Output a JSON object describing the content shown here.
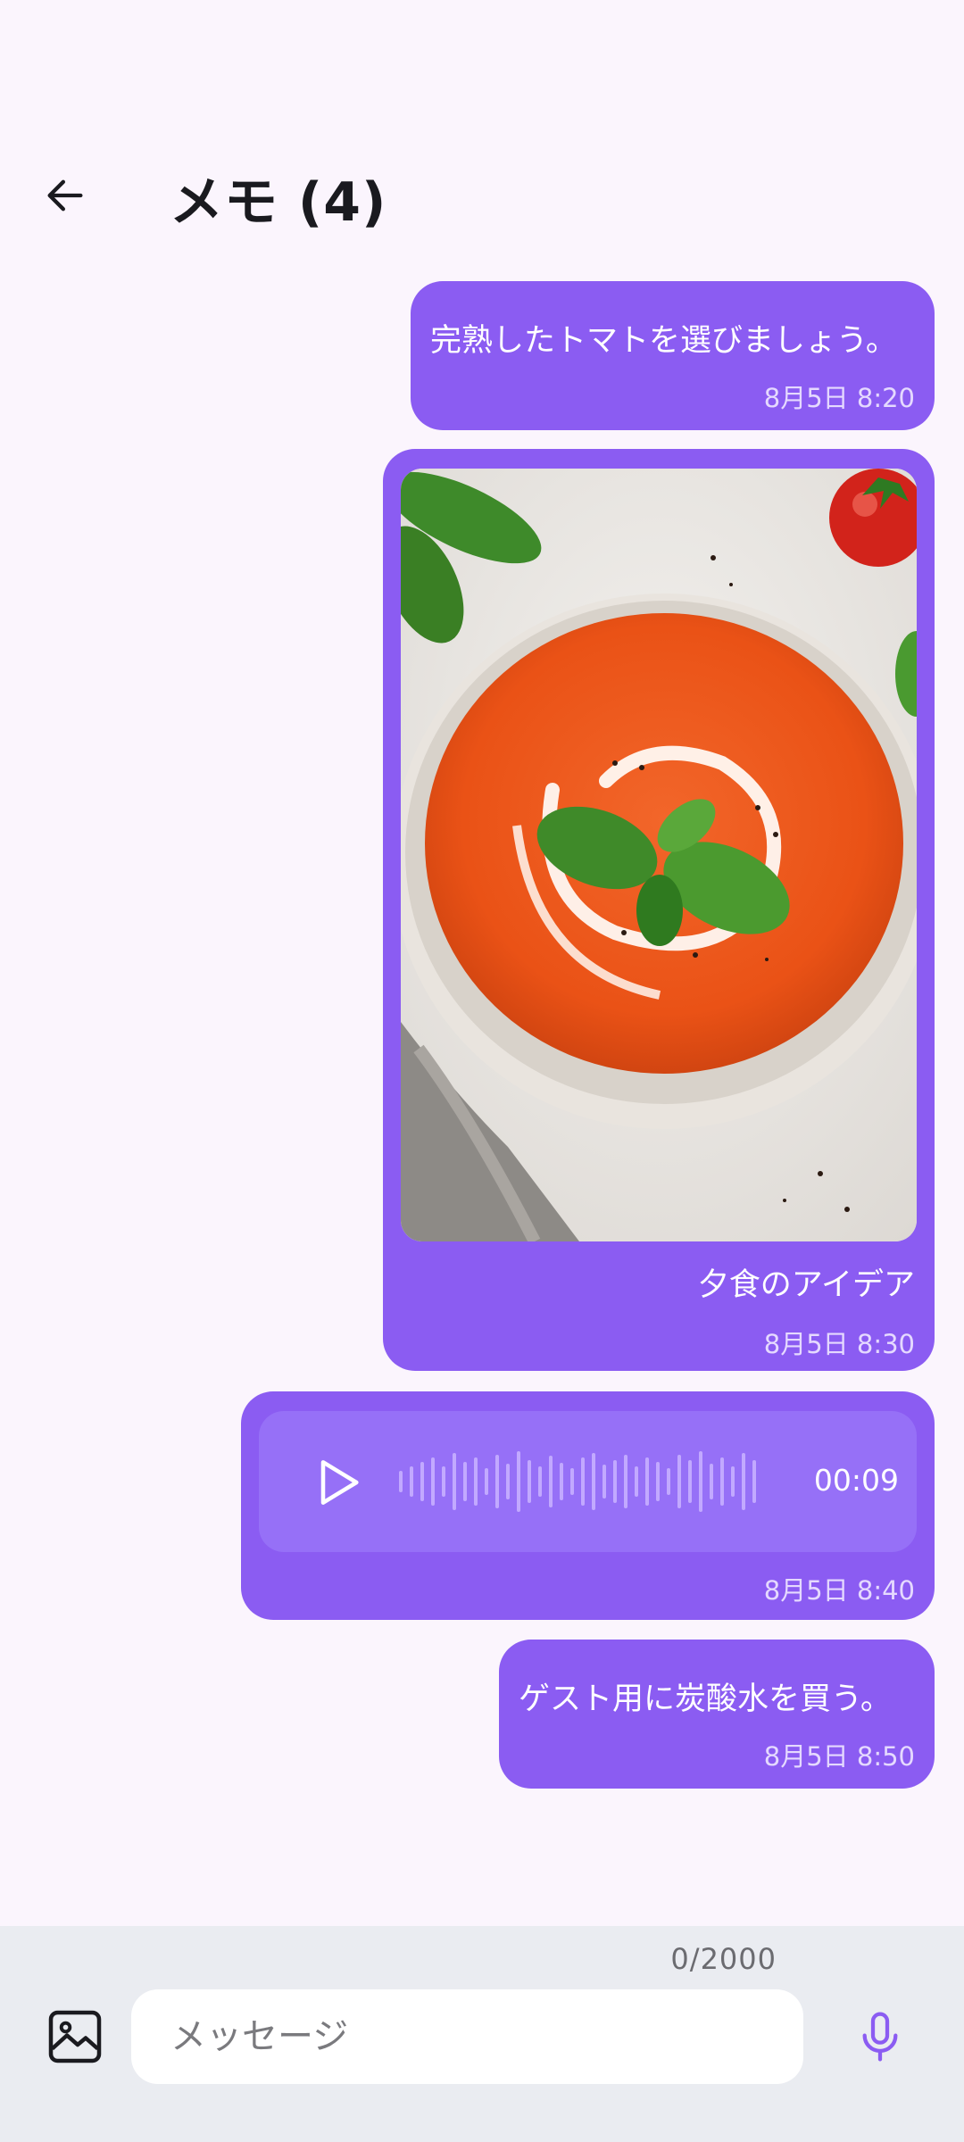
{
  "header": {
    "title": "メモ (4)"
  },
  "messages": [
    {
      "text": "完熟したトマトを選びましょう。",
      "time": "8月5日 8:20"
    },
    {
      "caption": "夕食のアイデア",
      "time": "8月5日 8:30"
    },
    {
      "duration": "00:09",
      "time": "8月5日 8:40"
    },
    {
      "text": "ゲスト用に炭酸水を買う。",
      "time": "8月5日 8:50"
    }
  ],
  "composer": {
    "counter": "0/2000",
    "placeholder": "メッセージ"
  },
  "icons": {
    "back": "arrow-left-icon",
    "gallery": "image-icon",
    "mic": "microphone-icon",
    "play": "play-icon"
  },
  "colors": {
    "bubble": "#8b5cf2",
    "accent": "#8b5cf2",
    "background": "#fbf5fd"
  }
}
